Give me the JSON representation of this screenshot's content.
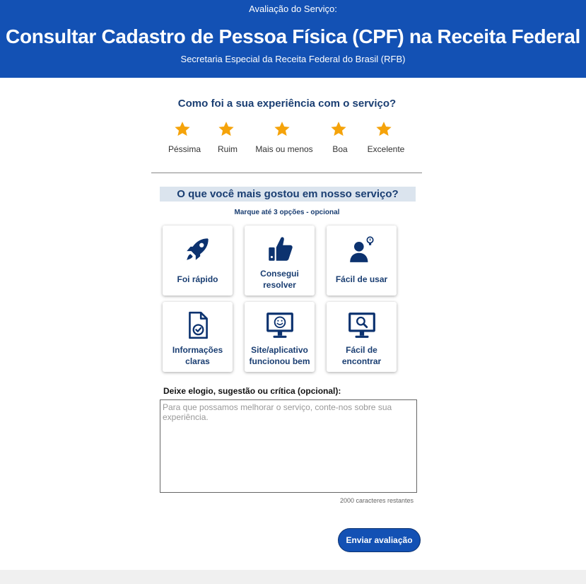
{
  "header": {
    "pre_title": "Avaliação do Serviço:",
    "title": "Consultar Cadastro de Pessoa Física (CPF) na Receita Federal",
    "subtitle": "Secretaria Especial da Receita Federal do Brasil (RFB)"
  },
  "rating": {
    "question": "Como foi a sua experiência com o serviço?",
    "star_color": "#f5a30a",
    "options": [
      {
        "label": "Péssima"
      },
      {
        "label": "Ruim"
      },
      {
        "label": "Mais ou menos"
      },
      {
        "label": "Boa"
      },
      {
        "label": "Excelente"
      }
    ]
  },
  "liked": {
    "title": "O que você mais gostou em nosso serviço?",
    "hint": "Marque até 3 opções - opcional",
    "options": [
      {
        "label": "Foi rápido",
        "icon": "rocket-icon"
      },
      {
        "label": "Consegui resolver",
        "icon": "thumbs-up-icon"
      },
      {
        "label": "Fácil de usar",
        "icon": "user-lightbulb-icon"
      },
      {
        "label": "Informações claras",
        "icon": "document-check-icon"
      },
      {
        "label": "Site/aplicativo funcionou bem",
        "icon": "monitor-smile-icon"
      },
      {
        "label": "Fácil de encontrar",
        "icon": "monitor-search-icon"
      }
    ]
  },
  "feedback": {
    "label": "Deixe elogio, sugestão ou crítica (opcional):",
    "placeholder": "Para que possamos melhorar o serviço, conte-nos sobre sua experiência.",
    "value": "",
    "counter": "2000 caracteres restantes"
  },
  "submit_label": "Enviar avaliação",
  "colors": {
    "brand_blue": "#1351b4",
    "navy_text": "#1a3e72",
    "icon_navy": "#0c326f"
  }
}
